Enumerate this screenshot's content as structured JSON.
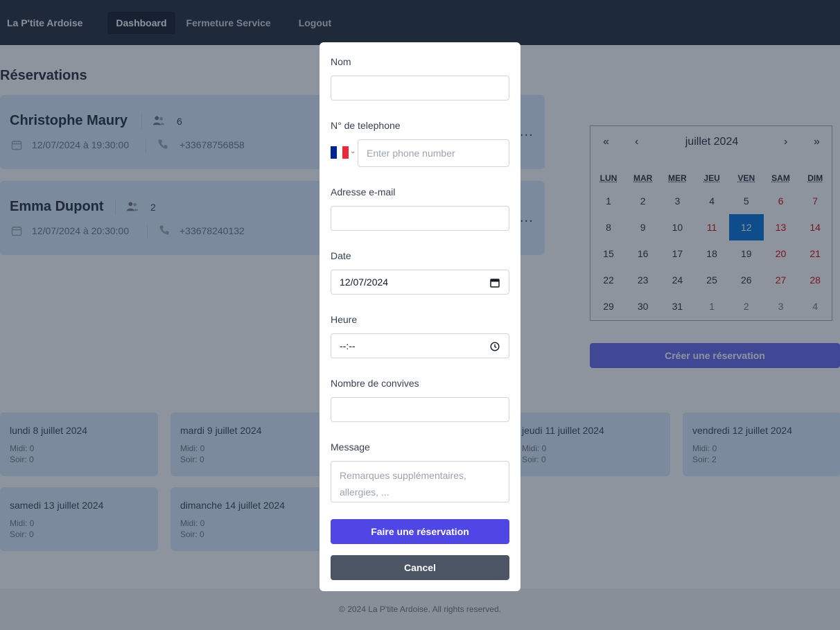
{
  "nav": {
    "brand": "La P'tite Ardoise",
    "links": [
      "Dashboard",
      "Fermeture Service",
      "Logout"
    ]
  },
  "page": {
    "title": "Réservations"
  },
  "reservations": [
    {
      "name": "Christophe Maury",
      "guests": "6",
      "datetime": "12/07/2024 à 19:30:00",
      "phone": "+33678756858",
      "more": "..."
    },
    {
      "name": "Emma Dupont",
      "guests": "2",
      "datetime": "12/07/2024 à 20:30:00",
      "phone": "+33678240132",
      "more": "..."
    }
  ],
  "calendar": {
    "nav": {
      "prev2": "«",
      "prev": "‹",
      "next": "›",
      "next2": "»"
    },
    "title": "juillet 2024",
    "weekdays": [
      "LUN",
      "MAR",
      "MER",
      "JEU",
      "VEN",
      "SAM",
      "DIM"
    ],
    "weeks": [
      [
        "1",
        "2",
        "3",
        "4",
        "5",
        "6",
        "7"
      ],
      [
        "8",
        "9",
        "10",
        "11",
        "12",
        "13",
        "14"
      ],
      [
        "15",
        "16",
        "17",
        "18",
        "19",
        "20",
        "21"
      ],
      [
        "22",
        "23",
        "24",
        "25",
        "26",
        "27",
        "28"
      ],
      [
        "29",
        "30",
        "31",
        "1",
        "2",
        "3",
        "4"
      ]
    ],
    "selected_day": "12"
  },
  "create_button": "Créer une réservation",
  "day_summaries": [
    {
      "title": "lundi 8 juillet 2024",
      "midi": "Midi: 0",
      "soir": "Soir: 0"
    },
    {
      "title": "mardi 9 juillet 2024",
      "midi": "Midi: 0",
      "soir": "Soir: 0"
    },
    {
      "title": "jeudi 11 juillet 2024",
      "midi": "Midi: 0",
      "soir": "Soir: 0"
    },
    {
      "title": "vendredi 12 juillet 2024",
      "midi": "Midi: 0",
      "soir": "Soir: 2"
    },
    {
      "title": "samedi 13 juillet 2024",
      "midi": "Midi: 0",
      "soir": "Soir: 0"
    },
    {
      "title": "dimanche 14 juillet 2024",
      "midi": "Midi: 0",
      "soir": "Soir: 0"
    }
  ],
  "footer": "© 2024 La P'tite Ardoise. All rights reserved.",
  "modal": {
    "nom_label": "Nom",
    "phone_label": "N° de telephone",
    "phone_placeholder": "Enter phone number",
    "email_label": "Adresse e-mail",
    "date_label": "Date",
    "date_value": "12/07/2024",
    "time_label": "Heure",
    "time_value": "--:--",
    "guests_label": "Nombre de convives",
    "message_label": "Message",
    "message_placeholder": "Remarques supplémentaires, allergies, ...",
    "submit": "Faire une réservation",
    "cancel": "Cancel"
  },
  "colors": {
    "accent": "#4f46e5",
    "selected_day": "#006edc",
    "cancel": "#4b5563"
  }
}
